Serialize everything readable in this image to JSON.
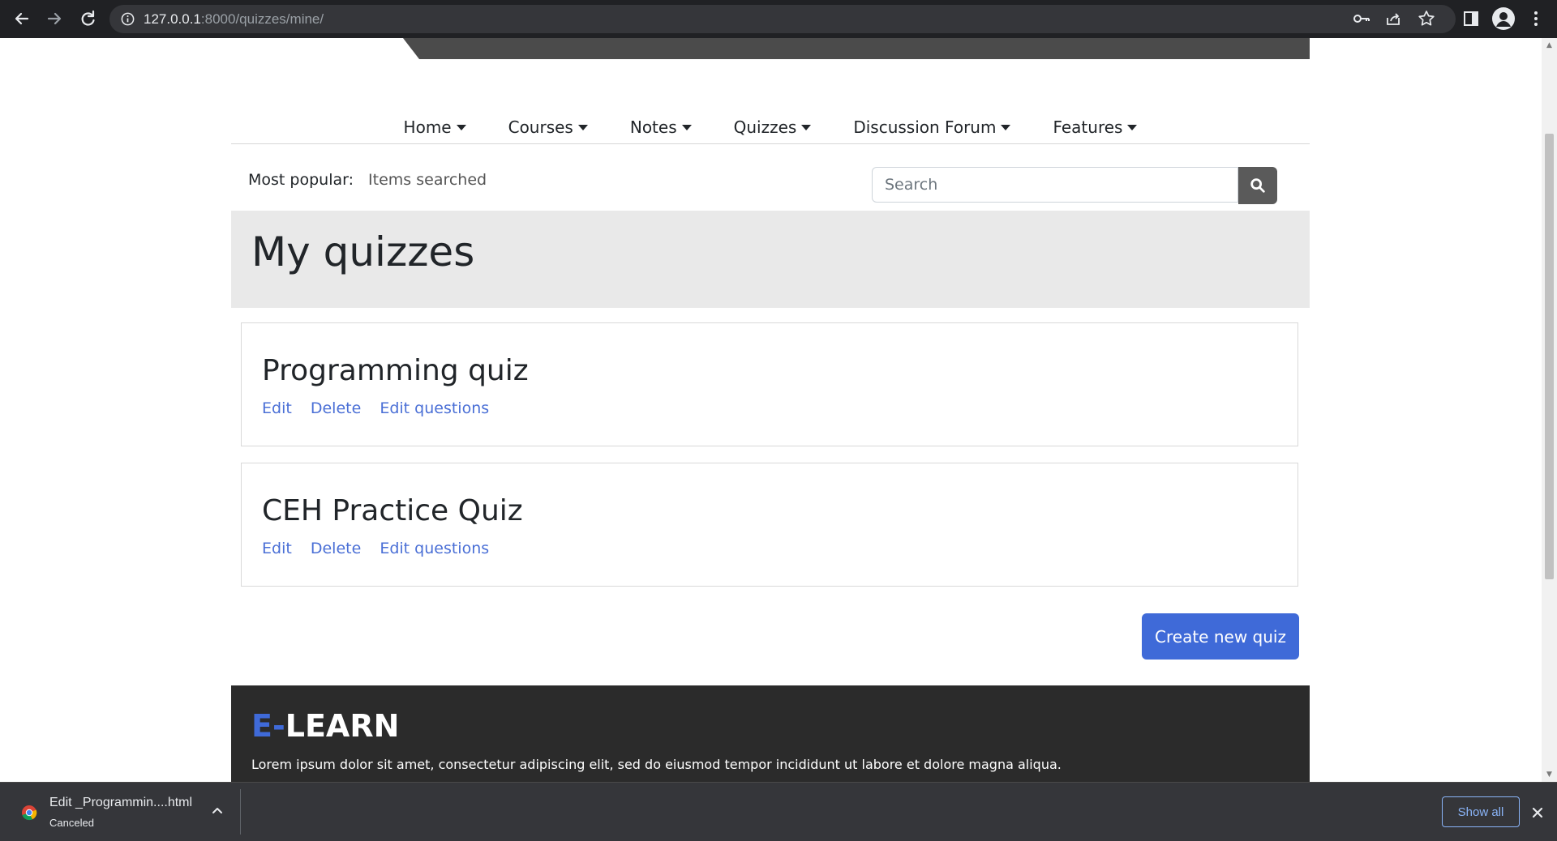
{
  "browser": {
    "url_host": "127.0.0.1",
    "url_rest": ":8000/quizzes/mine/"
  },
  "nav": {
    "items": [
      {
        "label": "Home"
      },
      {
        "label": "Courses"
      },
      {
        "label": "Notes"
      },
      {
        "label": "Quizzes"
      },
      {
        "label": "Discussion Forum"
      },
      {
        "label": "Features"
      }
    ]
  },
  "popular": {
    "label": "Most popular:",
    "value": "Items searched"
  },
  "search": {
    "placeholder": "Search"
  },
  "page": {
    "title": "My quizzes"
  },
  "quizzes": [
    {
      "title": "Programming quiz",
      "edit": "Edit",
      "delete": "Delete",
      "edit_questions": "Edit questions"
    },
    {
      "title": "CEH Practice Quiz",
      "edit": "Edit",
      "delete": "Delete",
      "edit_questions": "Edit questions"
    }
  ],
  "create_button": "Create new quiz",
  "footer": {
    "logo_accent": "E-",
    "logo_rest": "LEARN",
    "text": "Lorem ipsum dolor sit amet, consectetur adipiscing elit, sed do eiusmod tempor incididunt ut labore et dolore magna aliqua."
  },
  "download": {
    "filename": "Edit _Programmin....html",
    "status": "Canceled",
    "show_all": "Show all"
  },
  "colors": {
    "accent": "#3f6ad8",
    "link": "#4a6fd6",
    "footer_bg": "#2b2b2b",
    "title_band": "#e9e9e9"
  }
}
